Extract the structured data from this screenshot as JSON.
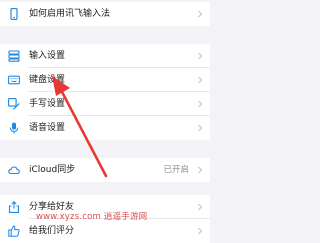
{
  "rows": {
    "how_to_enable": "如何启用讯飞输入法",
    "input_settings": "输入设置",
    "keyboard_settings": "键盘设置",
    "handwriting_settings": "手写设置",
    "voice_settings": "语音设置",
    "icloud_sync": "iCloud同步",
    "icloud_status": "已开启",
    "share_with_friends": "分享给好友",
    "rate_us": "给我们评分"
  },
  "watermark": "www.xyzs.com 逍遥手游网",
  "icons": {
    "how_to_enable": "phone-icon",
    "input_settings": "stack-icon",
    "keyboard_settings": "keyboard-icon",
    "handwriting_settings": "handwriting-icon",
    "voice_settings": "microphone-icon",
    "icloud_sync": "cloud-icon",
    "share_with_friends": "share-icon",
    "rate_us": "thumbs-up-icon"
  },
  "colors": {
    "icon": "#1e88e5",
    "arrow": "#e53935",
    "background": "#f2f2f7",
    "watermark": "#d9534f"
  }
}
